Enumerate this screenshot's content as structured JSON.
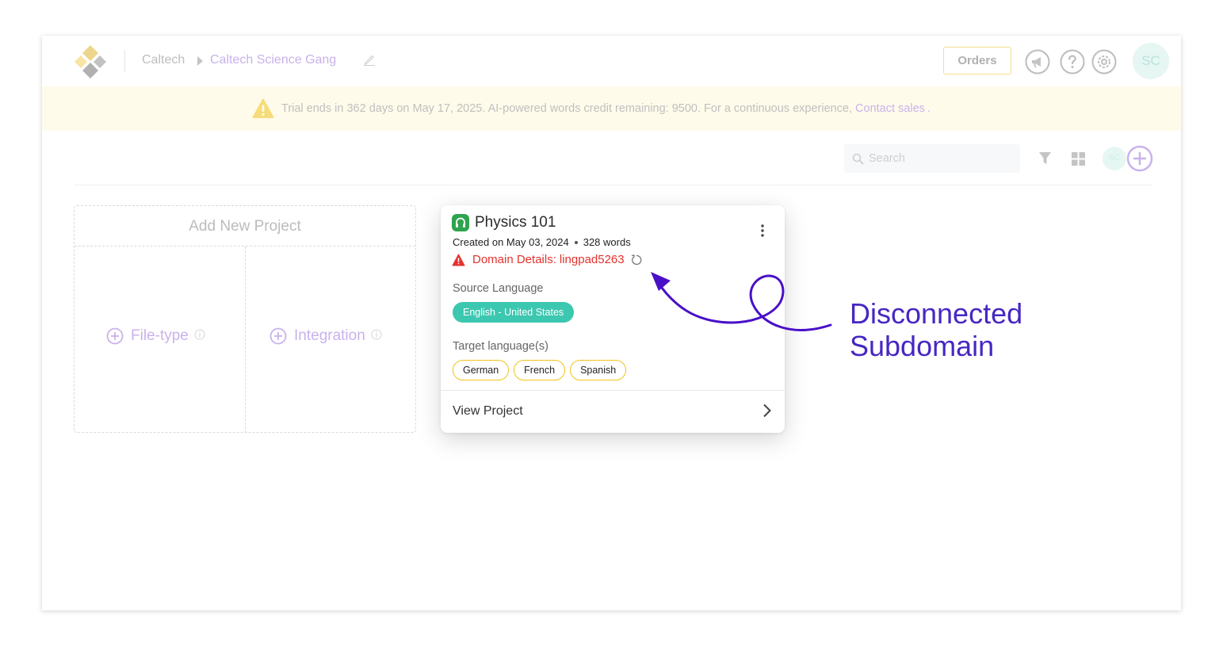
{
  "header": {
    "breadcrumb_root": "Caltech",
    "breadcrumb_current": "Caltech Science Gang",
    "orders_label": "Orders",
    "avatar_initials": "SC"
  },
  "banner": {
    "message": "Trial ends in 362 days on May 17, 2025. AI-powered words credit remaining: 9500. For a continuous experience,",
    "link_label": "Contact sales",
    "trailing": "."
  },
  "toolbar": {
    "search_placeholder": "Search",
    "avatar_initials": "SC"
  },
  "add_project": {
    "title": "Add New Project",
    "options": [
      "File-type",
      "Integration"
    ]
  },
  "project_card": {
    "title": "Physics 101",
    "created": "Created on May 03, 2024",
    "word_count": "328 words",
    "domain_label": "Domain Details:",
    "domain_name": "lingpad5263",
    "source_heading": "Source Language",
    "source_language": "English - United States",
    "target_heading": "Target language(s)",
    "target_languages": [
      "German",
      "French",
      "Spanish"
    ],
    "view_label": "View Project"
  },
  "annotation": {
    "line1": "Disconnected",
    "line2": "Subdomain",
    "color": "#4727c2"
  },
  "colors": {
    "accent_purple": "#c9b2ec",
    "banner_bg": "#fffbea",
    "error_red": "#e5322d",
    "source_chip": "#3cc7b0",
    "target_chip_border": "#f2c21e"
  }
}
